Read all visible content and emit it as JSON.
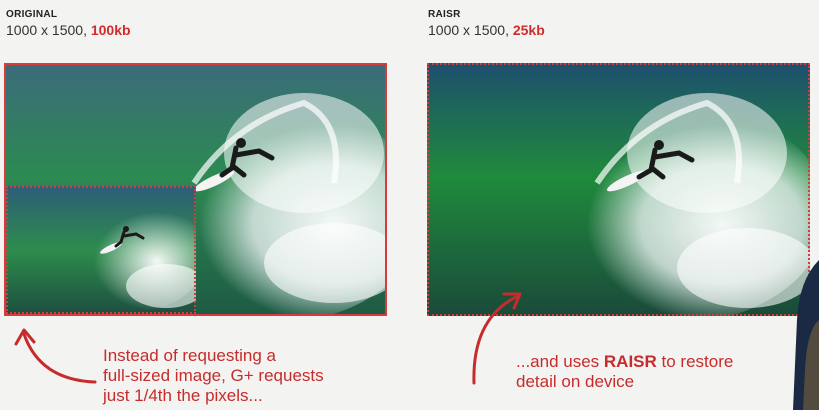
{
  "left_panel": {
    "label": "ORIGINAL",
    "dims": "1000 x 1500, ",
    "size": "100kb"
  },
  "right_panel": {
    "label": "RAISR",
    "dims": "1000 x 1500, ",
    "size": "25kb"
  },
  "annotations": {
    "left": {
      "line1": "Instead of requesting a",
      "line2": "full-sized image, G+ requests",
      "line3": "just 1/4th the pixels..."
    },
    "right": {
      "prefix": "...and uses ",
      "highlight": "RAISR",
      "suffix": " to restore",
      "line2": "detail on device"
    }
  },
  "colors": {
    "accent_red": "#d22b2b",
    "water_green": "#1f8a3c",
    "water_blue": "#1e4f6e",
    "spray_white": "#eef2f3"
  },
  "icons": {
    "left_arrow": "curved-arrow-icon",
    "right_arrow": "curved-arrow-icon"
  }
}
